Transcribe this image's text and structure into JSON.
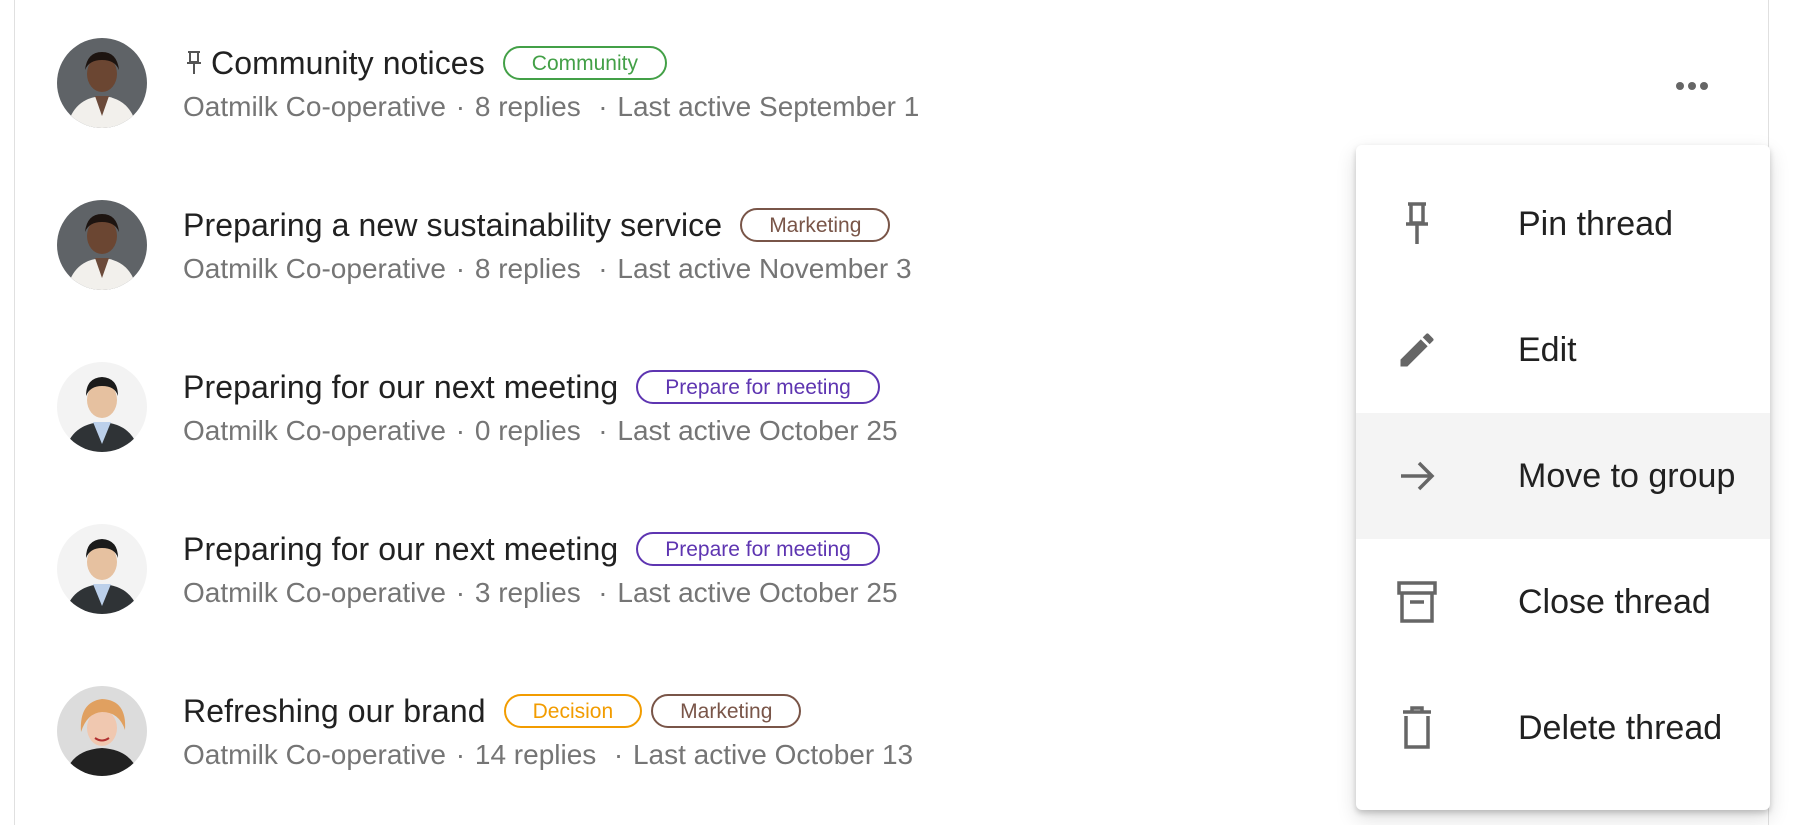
{
  "threads": [
    {
      "pinned": true,
      "title": "Community notices",
      "tags": [
        {
          "label": "Community",
          "color": "#43a047"
        }
      ],
      "group": "Oatmilk Co-operative",
      "replies": "8 replies",
      "last_active": "Last active September 1",
      "avatar": "woman-white-jacket"
    },
    {
      "pinned": false,
      "title": "Preparing a new sustainability service",
      "tags": [
        {
          "label": "Marketing",
          "color": "#795548"
        }
      ],
      "group": "Oatmilk Co-operative",
      "replies": "8 replies",
      "last_active": "Last active November 3",
      "avatar": "woman-white-jacket"
    },
    {
      "pinned": false,
      "title": "Preparing for our next meeting",
      "tags": [
        {
          "label": "Prepare for meeting",
          "color": "#5e35b1"
        }
      ],
      "group": "Oatmilk Co-operative",
      "replies": "0 replies",
      "last_active": "Last active October 25",
      "avatar": "man-suit"
    },
    {
      "pinned": false,
      "title": "Preparing for our next meeting",
      "tags": [
        {
          "label": "Prepare for meeting",
          "color": "#5e35b1"
        }
      ],
      "group": "Oatmilk Co-operative",
      "replies": "3 replies",
      "last_active": "Last active October 25",
      "avatar": "man-suit"
    },
    {
      "pinned": false,
      "title": "Refreshing our brand",
      "tags": [
        {
          "label": "Decision",
          "color": "#f29c00"
        },
        {
          "label": "Marketing",
          "color": "#795548"
        }
      ],
      "group": "Oatmilk Co-operative",
      "replies": "14 replies",
      "last_active": "Last active October 13",
      "avatar": "woman-blonde"
    }
  ],
  "separator": "·",
  "more_button_icon": "more-horizontal-icon",
  "context_menu": {
    "items": [
      {
        "label": "Pin thread",
        "icon": "pin-icon",
        "active": false
      },
      {
        "label": "Edit",
        "icon": "pencil-icon",
        "active": false
      },
      {
        "label": "Move to group",
        "icon": "arrow-right-icon",
        "active": true
      },
      {
        "label": "Close thread",
        "icon": "archive-icon",
        "active": false
      },
      {
        "label": "Delete thread",
        "icon": "trash-icon",
        "active": false
      }
    ]
  },
  "colors": {
    "title": "#212121",
    "meta": "#757575",
    "icon": "#666666",
    "menu_active_bg": "#f4f4f4"
  }
}
